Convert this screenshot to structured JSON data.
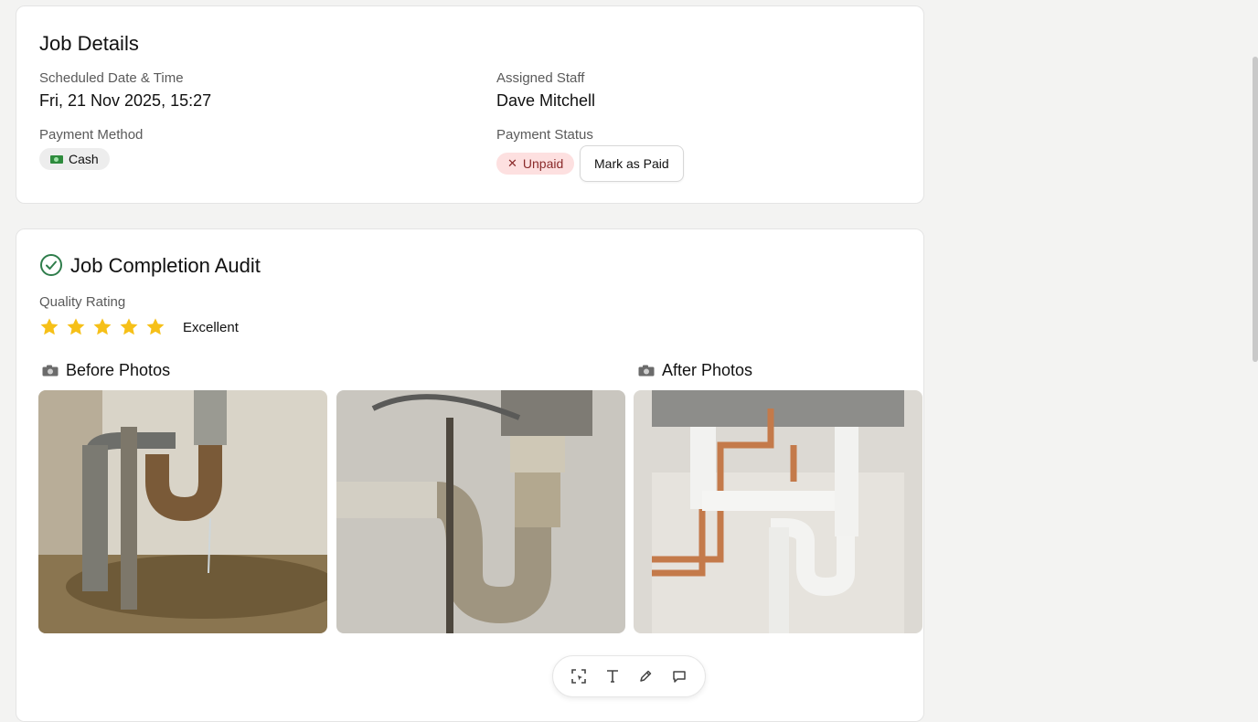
{
  "job_details": {
    "title": "Job Details",
    "scheduled_label": "Scheduled Date & Time",
    "scheduled_value": "Fri, 21 Nov 2025, 15:27",
    "staff_label": "Assigned Staff",
    "staff_value": "Dave Mitchell",
    "payment_method_label": "Payment Method",
    "payment_method_value": "Cash",
    "payment_status_label": "Payment Status",
    "payment_status_value": "Unpaid",
    "mark_paid_label": "Mark as Paid"
  },
  "audit": {
    "title": "Job Completion Audit",
    "quality_label": "Quality Rating",
    "rating_stars": 5,
    "rating_max": 5,
    "rating_text": "Excellent",
    "before_label": "Before Photos",
    "after_label": "After Photos"
  },
  "toolbar": {
    "tools": [
      "select-area-icon",
      "text-icon",
      "pencil-icon",
      "comment-icon"
    ]
  },
  "colors": {
    "star": "#f6c018",
    "check": "#2f7d4b",
    "unpaid_bg": "#fde0e0"
  }
}
